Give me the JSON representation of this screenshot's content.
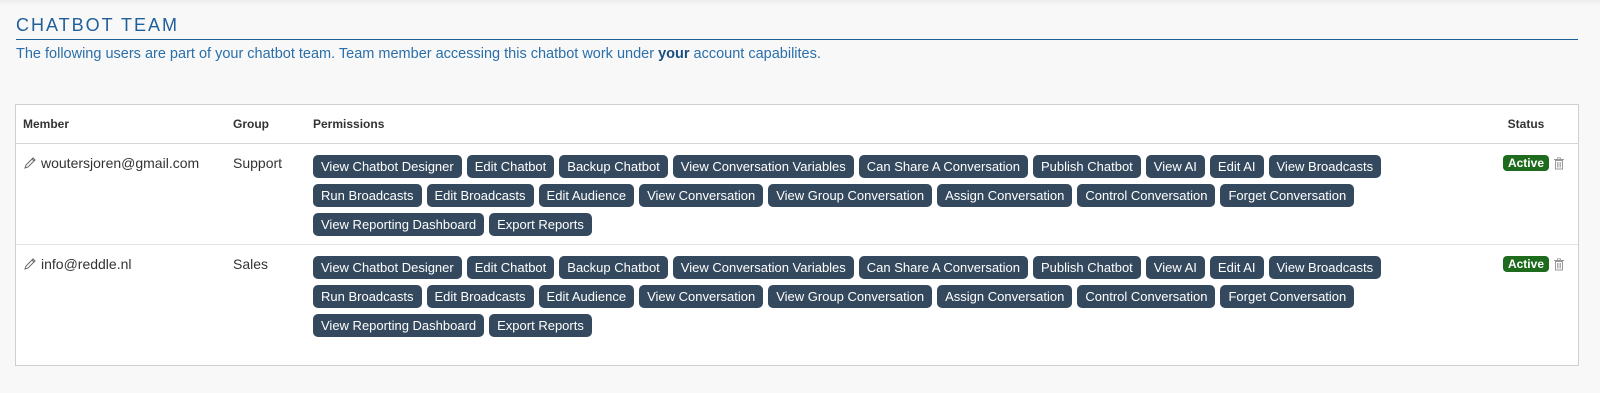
{
  "section": {
    "title": "CHATBOT TEAM",
    "intro_before": "The following users are part of your chatbot team. Team member accessing this chatbot work under ",
    "intro_bold": "your",
    "intro_after": " account capabilites."
  },
  "table": {
    "headers": {
      "member": "Member",
      "group": "Group",
      "permissions": "Permissions",
      "status": "Status"
    },
    "rows": [
      {
        "member": "woutersjoren@gmail.com",
        "group": "Support",
        "status": "Active",
        "permissions": [
          "View Chatbot Designer",
          "Edit Chatbot",
          "Backup Chatbot",
          "View Conversation Variables",
          "Can Share A Conversation",
          "Publish Chatbot",
          "View AI",
          "Edit AI",
          "View Broadcasts",
          "Run Broadcasts",
          "Edit Broadcasts",
          "Edit Audience",
          "View Conversation",
          "View Group Conversation",
          "Assign Conversation",
          "Control Conversation",
          "Forget Conversation",
          "View Reporting Dashboard",
          "Export Reports"
        ]
      },
      {
        "member": "info@reddle.nl",
        "group": "Sales",
        "status": "Active",
        "permissions": [
          "View Chatbot Designer",
          "Edit Chatbot",
          "Backup Chatbot",
          "View Conversation Variables",
          "Can Share A Conversation",
          "Publish Chatbot",
          "View AI",
          "Edit AI",
          "View Broadcasts",
          "Run Broadcasts",
          "Edit Broadcasts",
          "Edit Audience",
          "View Conversation",
          "View Group Conversation",
          "Assign Conversation",
          "Control Conversation",
          "Forget Conversation",
          "View Reporting Dashboard",
          "Export Reports"
        ]
      }
    ]
  },
  "icons": {
    "edit": "pencil-icon",
    "delete": "trash-icon"
  },
  "colors": {
    "title": "#1f5f9a",
    "permission_bg": "#34495e",
    "active_badge": "#1e6b1e"
  }
}
